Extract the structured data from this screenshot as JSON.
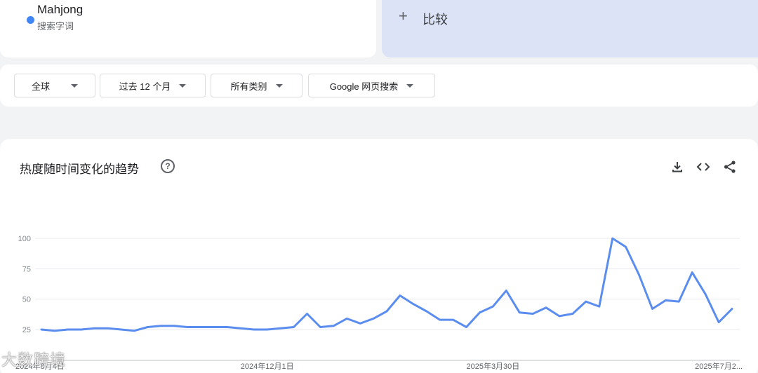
{
  "term": {
    "name": "Mahjong",
    "subtitle": "搜索字词",
    "color": "#4285f4"
  },
  "compare": {
    "plus": "+",
    "label": "比较"
  },
  "filters": {
    "region": "全球",
    "period": "过去 12 个月",
    "category": "所有类别",
    "source": "Google 网页搜索"
  },
  "chart_card": {
    "title": "热度随时间变化的趋势",
    "help": "?",
    "tools": [
      "download-icon",
      "embed-code-icon",
      "share-icon"
    ]
  },
  "watermark": "大数跨境",
  "chart_data": {
    "type": "line",
    "title": "",
    "xlabel": "",
    "ylabel": "",
    "ylim": [
      0,
      100
    ],
    "yticks": [
      25,
      50,
      75,
      100
    ],
    "grid": true,
    "x_tick_labels": [
      "2024年8月4日",
      "2024年12月1日",
      "2025年3月30日",
      "2025年7月2..."
    ],
    "x_tick_indices": [
      0,
      17,
      34,
      51
    ],
    "series": [
      {
        "color": "#5b8def",
        "values": [
          25,
          24,
          25,
          25,
          26,
          26,
          25,
          24,
          27,
          28,
          28,
          27,
          27,
          27,
          27,
          26,
          25,
          25,
          26,
          27,
          38,
          27,
          28,
          34,
          30,
          34,
          40,
          53,
          46,
          40,
          33,
          33,
          27,
          39,
          44,
          57,
          39,
          38,
          43,
          36,
          38,
          48,
          44,
          100,
          93,
          70,
          42,
          49,
          48,
          72,
          54,
          31,
          42
        ]
      }
    ]
  }
}
